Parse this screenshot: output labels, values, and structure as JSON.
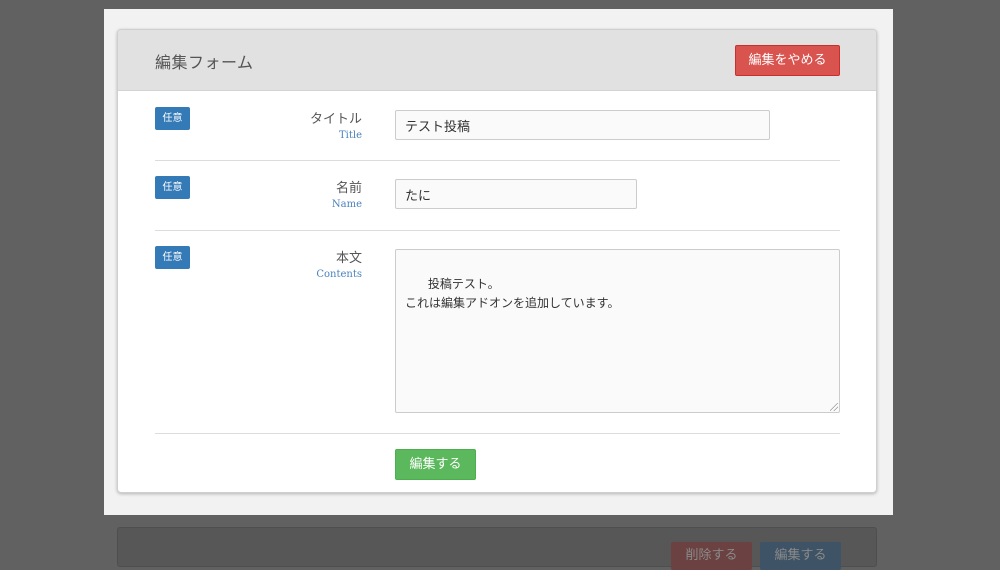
{
  "header": {
    "title": "編集フォーム",
    "cancel_label": "編集をやめる"
  },
  "fields": [
    {
      "badge": "任意",
      "label": "タイトル",
      "sublabel": "Title",
      "value": "テスト投稿"
    },
    {
      "badge": "任意",
      "label": "名前",
      "sublabel": "Name",
      "value": "たに"
    },
    {
      "badge": "任意",
      "label": "本文",
      "sublabel": "Contents",
      "value": "投稿テスト。\nこれは編集アドオンを追加しています。"
    }
  ],
  "submit_label": "編集する",
  "background_actions": {
    "delete_label": "削除する",
    "edit_label": "編集する"
  },
  "colors": {
    "danger": "#d9534f",
    "success": "#5cb85c",
    "primary": "#337ab7"
  }
}
